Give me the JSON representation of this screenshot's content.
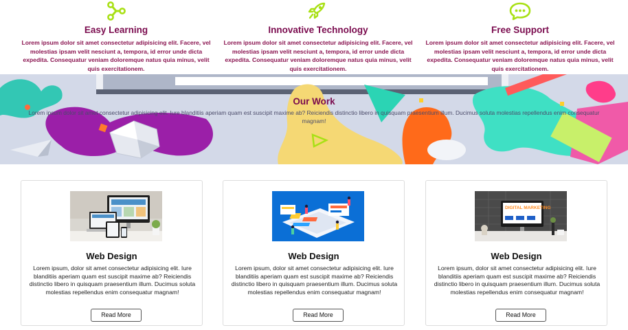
{
  "features": [
    {
      "icon": "share-nodes-icon",
      "title": "Easy Learning",
      "text": "Lorem ipsum dolor sit amet consectetur adipisicing elit. Facere, vel molestias ipsam velit nesciunt a, tempora, id error unde dicta expedita. Consequatur veniam doloremque natus quia minus, velit quis exercitationem."
    },
    {
      "icon": "rocket-icon",
      "title": "Innovative Technology",
      "text": "Lorem ipsum dolor sit amet consectetur adipisicing elit. Facere, vel molestias ipsam velit nesciunt a, tempora, id error unde dicta expedita. Consequatur veniam doloremque natus quia minus, velit quis exercitationem."
    },
    {
      "icon": "chat-bubble-icon",
      "title": "Free Support",
      "text": "Lorem ipsum dolor sit amet consectetur adipisicing elit. Facere, vel molestias ipsam velit nesciunt a, tempora, id error unde dicta expedita. Consequatur veniam doloremque natus quia minus, velit quis exercitationem."
    }
  ],
  "banner": {
    "title": "Our Work",
    "text": "Lorem ipsum dolor sit amet consectetur adipisicing elit. Iure blanditiis aperiam quam est suscipit maxime ab? Reiciendis distinctio libero in quisquam praesentium illum. Ducimus soluta molestias repellendus enim consequatur magnam!"
  },
  "cards": [
    {
      "image": "devices-mockup-image",
      "title": "Web Design",
      "text": "Lorem ipsum, dolor sit amet consectetur adipisicing elit. Iure blanditiis aperiam quam est suscipit maxime ab? Reiciendis distinctio libero in quisquam praesentium illum. Ducimus soluta molestias repellendus enim consequatur magnam!",
      "button": "Read More"
    },
    {
      "image": "web-dev-illustration-image",
      "title": "Web Design",
      "text": "Lorem ipsum, dolor sit amet consectetur adipisicing elit. Iure blanditiis aperiam quam est suscipit maxime ab? Reiciendis distinctio libero in quisquam praesentium illum. Ducimus soluta molestias repellendus enim consequatur magnam!",
      "button": "Read More"
    },
    {
      "image": "digital-marketing-desk-image",
      "title": "Web Design",
      "text": "Lorem ipsum, dolor sit amet consectetur adipisicing elit. Iure blanditiis aperiam quam est suscipit maxime ab? Reiciendis distinctio libero in quisquam praesentium illum. Ducimus soluta molestias repellendus enim consequatur magnam!",
      "button": "Read More"
    }
  ],
  "image_text": {
    "digital_marketing": "DIGITAL MARKETING"
  },
  "colors": {
    "accent_green": "#a8e014",
    "heading_maroon": "#7a0b4e",
    "text_maroon": "#8a1450"
  }
}
